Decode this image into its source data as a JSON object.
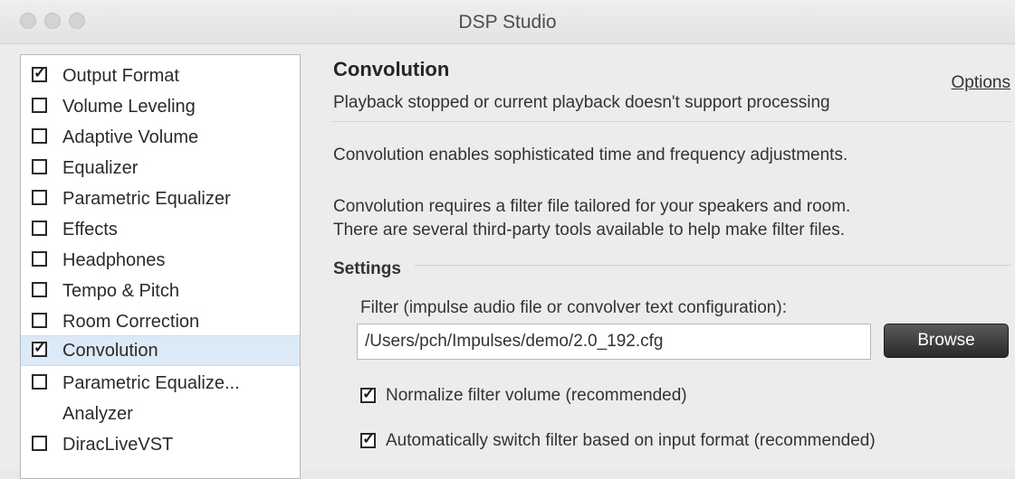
{
  "window": {
    "title": "DSP Studio"
  },
  "sidebar": {
    "items": [
      {
        "label": "Output Format",
        "checked": true
      },
      {
        "label": "Volume Leveling",
        "checked": false
      },
      {
        "label": "Adaptive Volume",
        "checked": false
      },
      {
        "label": "Equalizer",
        "checked": false
      },
      {
        "label": "Parametric Equalizer",
        "checked": false
      },
      {
        "label": "Effects",
        "checked": false
      },
      {
        "label": "Headphones",
        "checked": false
      },
      {
        "label": "Tempo & Pitch",
        "checked": false
      },
      {
        "label": "Room Correction",
        "checked": false
      },
      {
        "label": "Convolution",
        "checked": true,
        "selected": true
      },
      {
        "label": "Parametric Equalize...",
        "checked": false
      },
      {
        "label": "Analyzer",
        "checked": null
      },
      {
        "label": "DiracLiveVST",
        "checked": false
      }
    ],
    "check_glyph": "✓"
  },
  "main": {
    "title": "Convolution",
    "status": "Playback stopped or current playback doesn't support processing",
    "options_link": "Options",
    "description_1": "Convolution enables sophisticated time and frequency adjustments.",
    "description_2_line1": "Convolution requires a filter file tailored for your speakers and room.",
    "description_2_line2": "There are several third-party tools available to help make filter files.",
    "settings_label": "Settings",
    "filter_label": "Filter (impulse audio file or convolver text configuration):",
    "filter_path": "/Users/pch/Impulses/demo/2.0_192.cfg",
    "browse_label": "Browse",
    "normalize_label": "Normalize filter volume (recommended)",
    "normalize_checked": true,
    "auto_switch_label": "Automatically switch filter based on input format (recommended)",
    "auto_switch_checked": true
  }
}
